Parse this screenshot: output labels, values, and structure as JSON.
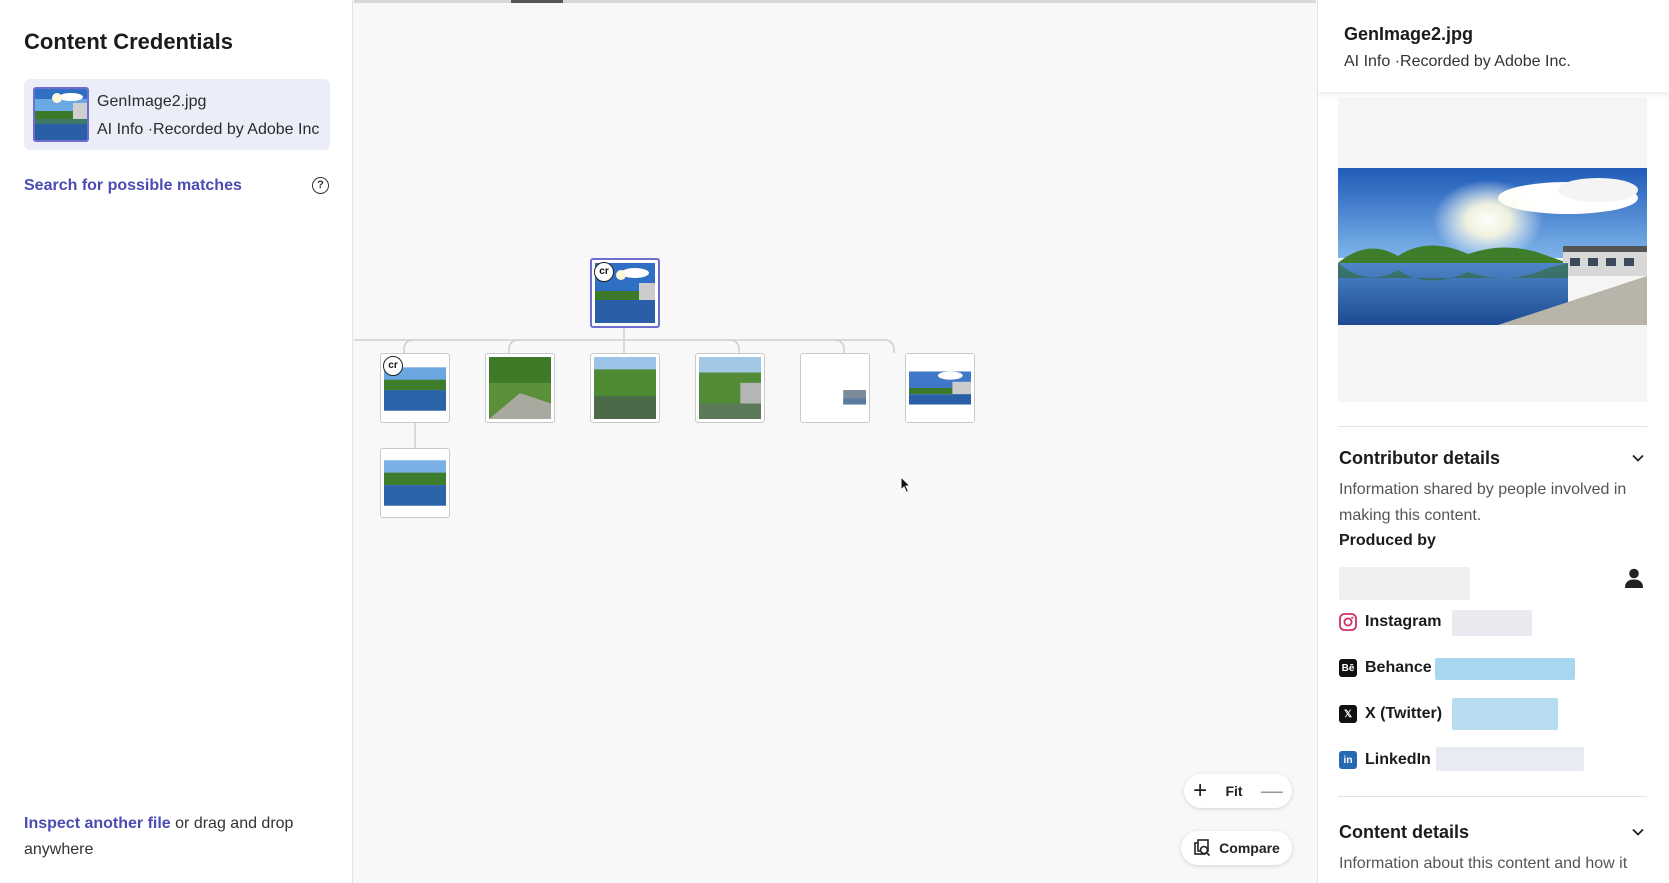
{
  "sidebar": {
    "title": "Content Credentials",
    "file": {
      "name": "GenImage2.jpg",
      "subtitle": "AI Info ·Recorded by Adobe Inc"
    },
    "search_link": "Search for possible matches",
    "help_icon": "?",
    "inspect_link": "Inspect another file",
    "inspect_tail": " or drag and drop anywhere"
  },
  "canvas": {
    "badge_label": "cr",
    "zoom": {
      "in": "+",
      "fit": "Fit",
      "out": "—"
    },
    "compare_label": "Compare"
  },
  "right_panel": {
    "title": "GenImage2.jpg",
    "subtitle": "AI Info ·Recorded by Adobe Inc.",
    "contributor": {
      "title": "Contributor details",
      "description": "Information shared by people involved in making this content.",
      "produced_by": "Produced by"
    },
    "socials": [
      {
        "label": "Instagram",
        "icon": "instagram-icon"
      },
      {
        "label": "Behance",
        "icon": "behance-icon"
      },
      {
        "label": "X (Twitter)",
        "icon": "x-twitter-icon"
      },
      {
        "label": "LinkedIn",
        "icon": "linkedin-icon"
      }
    ],
    "content": {
      "title": "Content details",
      "description": "Information about this content and how it"
    }
  },
  "colors": {
    "accent": "#4b4bb3",
    "selected_border": "#6e6ed0",
    "card_bg": "#ebedf8"
  }
}
